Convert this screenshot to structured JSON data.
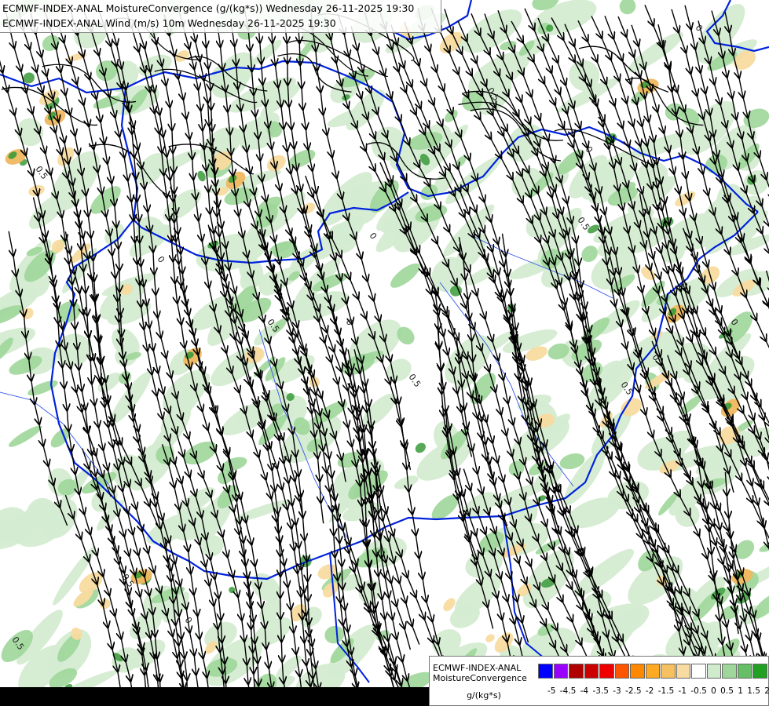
{
  "titles": {
    "line1": "ECMWF-INDEX-ANAL MoistureConvergence (g/(kg*s)) Wednesday 26-11-2025 19:30",
    "line2": "ECMWF-INDEX-ANAL Wind (m/s) 10m Wednesday 26-11-2025 19:30"
  },
  "legend": {
    "title_line1": "ECMWF-INDEX-ANAL",
    "title_line2": "MoistureConvergence",
    "unit": "g/(kg*s)",
    "tick_text": "-5 -4.5 -4 -3.5 -3 -2.5 -2 -1.5 -1 -0.5 0 0.5 1 1.5 2",
    "swatch_colors": [
      "#0000ff",
      "#9900ff",
      "#b00000",
      "#cc0000",
      "#ee0000",
      "#ff5500",
      "#ff8800",
      "#ffaa22",
      "#f5c060",
      "#f8dba0",
      "#ffffff",
      "#cfeacc",
      "#9fd69a",
      "#66bf66",
      "#22a022"
    ]
  },
  "contour_labels": [
    "0.5",
    "0",
    "-0.5"
  ],
  "colors": {
    "green_light": "#d4ecd1",
    "green_mid": "#9fd69a",
    "green_dark": "#3a9a3a",
    "orange_light": "#f8dba0",
    "orange_mid": "#f0b860",
    "border_blue": "#0022dd",
    "river_blue": "#3355ee",
    "streamline": "#000000"
  }
}
